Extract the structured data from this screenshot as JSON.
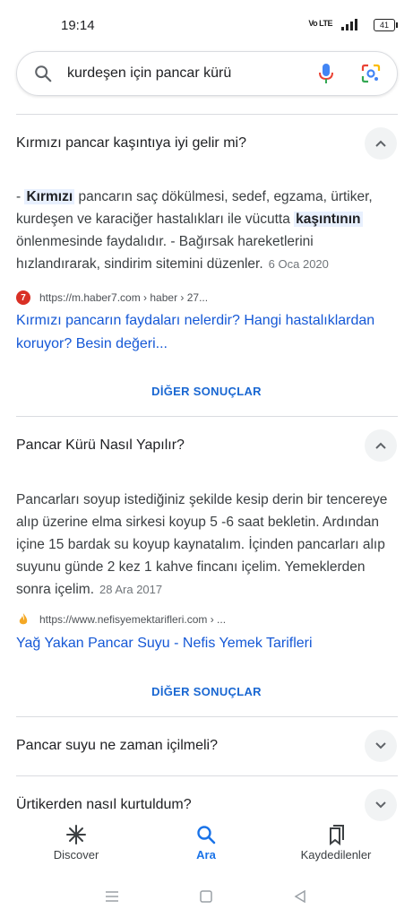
{
  "status": {
    "time": "19:14",
    "signal": "Vo LTE",
    "network": "4G",
    "battery": "41"
  },
  "search": {
    "query": "kurdeşen için pancar kürü"
  },
  "faq": [
    {
      "question": "Kırmızı pancar kaşıntıya iyi gelir mi?",
      "answer_pre": "- ",
      "answer_hl1": "Kırmızı",
      "answer_mid": " pancarın saç dökülmesi, sedef, egzama, ürtiker, kurdeşen ve karaciğer hastalıkları ile vücutta ",
      "answer_hl2": "kaşıntının",
      "answer_post": " önlenmesinde faydalıdır. - Bağırsak hareketlerini hızlandırarak, sindirim sitemini düzenler.",
      "date": "6 Oca 2020",
      "favicon": "7",
      "source_url": "https://m.haber7.com › haber › 27...",
      "link_text": "Kırmızı pancarın faydaları nelerdir? Hangi hastalıklardan koruyor? Besin değeri...",
      "more_label": "DİĞER SONUÇLAR"
    },
    {
      "question": "Pancar Kürü Nasıl Yapılır?",
      "answer": "Pancarları soyup istediğiniz şekilde kesip derin bir tencereye alıp üzerine elma sirkesi koyup 5 -6 saat bekletin. Ardından içine 15 bardak su koyup kaynatalım. İçinden pancarları alıp suyunu günde 2 kez 1 kahve fincanı içelim. Yemeklerden sonra içelim.",
      "date": "28 Ara 2017",
      "source_url": "https://www.nefisyemektarifleri.com › ...",
      "link_text": "Yağ Yakan Pancar Suyu - Nefis Yemek Tarifleri",
      "more_label": "DİĞER SONUÇLAR"
    },
    {
      "question": "Pancar suyu ne zaman içilmeli?"
    },
    {
      "question": "Ürtikerden nasıl kurtuldum?"
    }
  ],
  "bottom_nav": [
    {
      "label": "Discover",
      "icon": "asterisk-icon"
    },
    {
      "label": "Ara",
      "icon": "search-icon"
    },
    {
      "label": "Kaydedilenler",
      "icon": "bookmarks-icon"
    }
  ],
  "colors": {
    "link": "#1558d6",
    "more": "#1967d2",
    "active_nav": "#1a73e8",
    "highlight_bg": "#e8f0fe"
  }
}
